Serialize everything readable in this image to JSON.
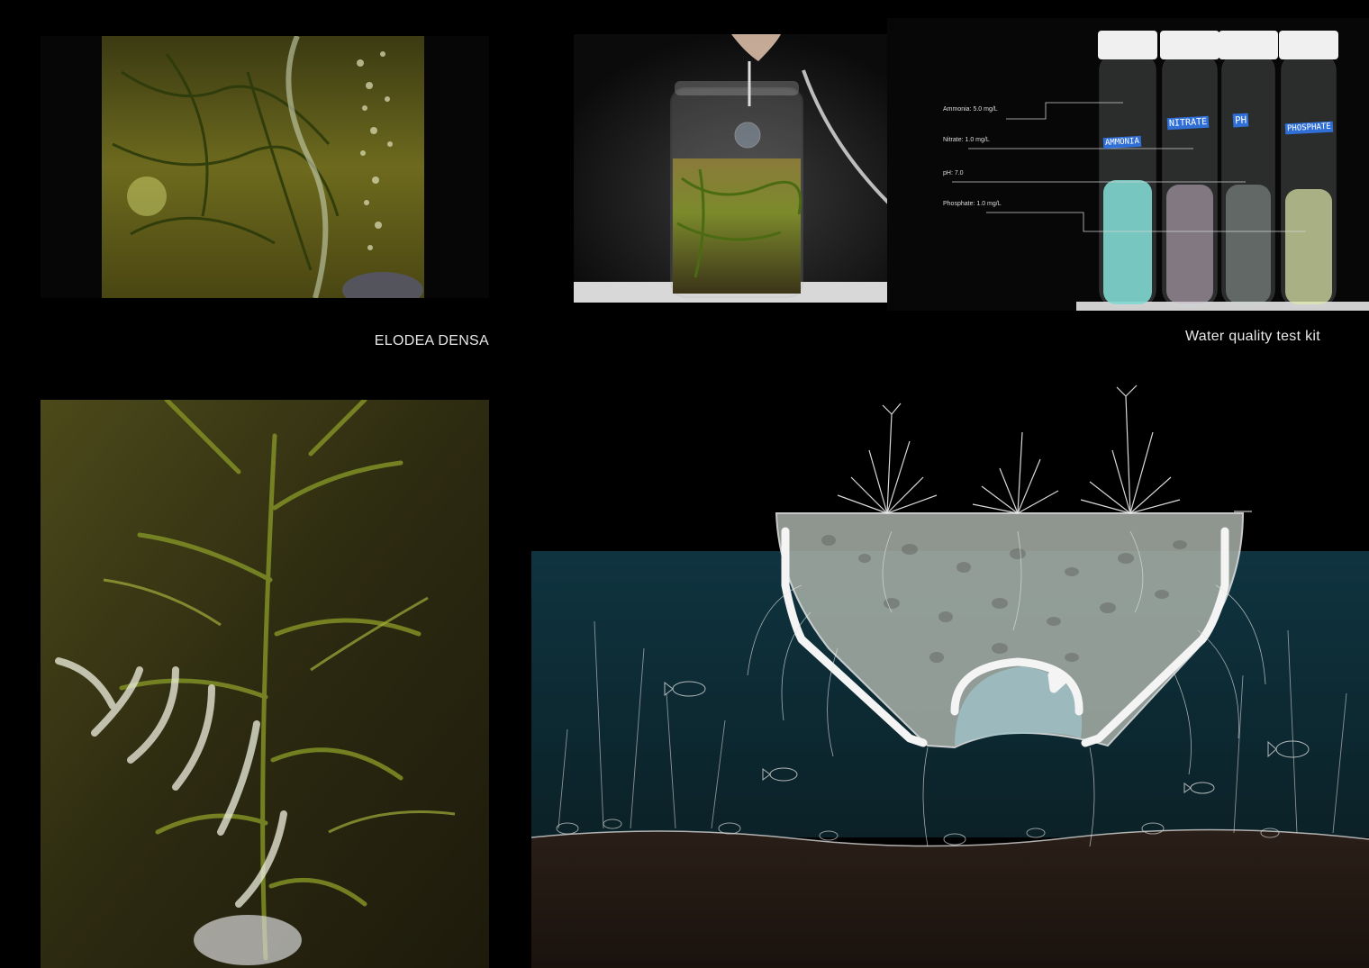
{
  "captions": {
    "elodea": "ELODEA DENSA",
    "test_kit": "Water quality test kit"
  },
  "test_kit": {
    "readings": [
      {
        "label": "Ammonia: 5.0 mg/L"
      },
      {
        "label": "Nitrate: 1.0 mg/L"
      },
      {
        "label": "pH: 7.0"
      },
      {
        "label": "Phosphate: 1.0 mg/L"
      }
    ],
    "tube_labels": [
      "AMMONIA",
      "NITRATE",
      "PH",
      "PHOSPHATE"
    ]
  },
  "colors": {
    "background": "#000000",
    "water": "#0e2a33",
    "soil": "#2a1f18",
    "plant_green": "#6a7a1c",
    "tube_blue_label": "#2f6fd6",
    "ammonia_sample": "#7fd8d0",
    "nitrate_sample": "#c9b7c8",
    "ph_sample": "#c8d8d0",
    "phosphate_sample": "#dfe8a8"
  }
}
